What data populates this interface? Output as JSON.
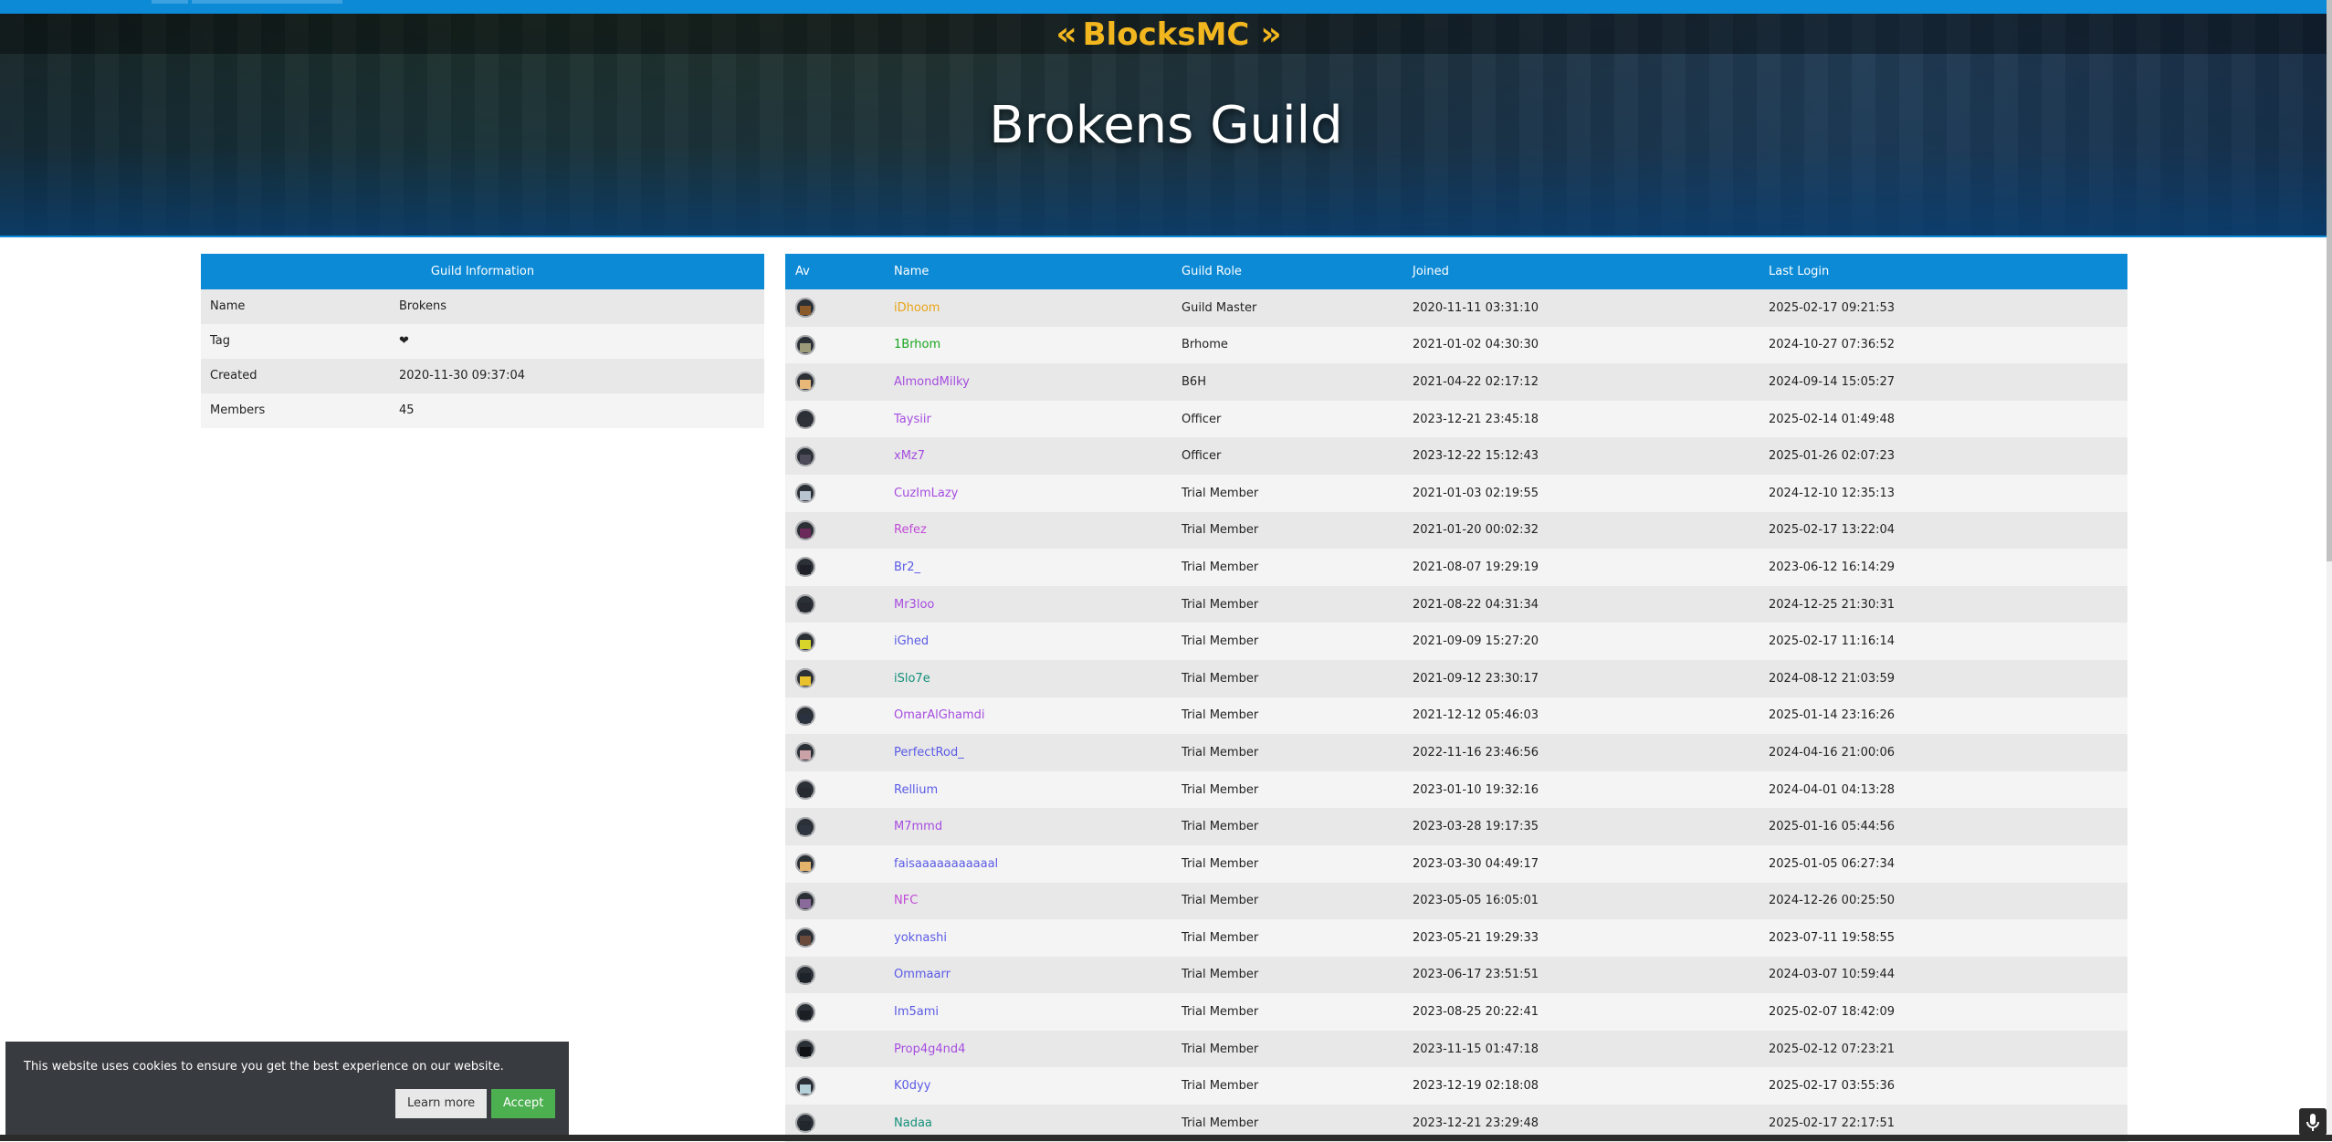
{
  "site": {
    "logo_text": "BlocksMC",
    "logo_left": "«",
    "logo_right": "»"
  },
  "page": {
    "title": "Brokens Guild"
  },
  "guild_info": {
    "header": "Guild Information",
    "rows": [
      {
        "label": "Name",
        "value": "Brokens"
      },
      {
        "label": "Tag",
        "value": "❤"
      },
      {
        "label": "Created",
        "value": "2020-11-30 09:37:04"
      },
      {
        "label": "Members",
        "value": "45"
      }
    ]
  },
  "members_table": {
    "columns": {
      "av": "Av",
      "name": "Name",
      "role": "Guild Role",
      "joined": "Joined",
      "last_login": "Last Login"
    },
    "rows": [
      {
        "name": "iDhoom",
        "name_color": "#e9a416",
        "avatar_color": "#8a5a2a",
        "role": "Guild Master",
        "joined": "2020-11-11 03:31:10",
        "last_login": "2025-02-17 09:21:53"
      },
      {
        "name": "1Brhom",
        "name_color": "#19a51f",
        "avatar_color": "#9b9b7a",
        "role": "Brhome",
        "joined": "2021-01-02 04:30:30",
        "last_login": "2024-10-27 07:36:52"
      },
      {
        "name": "AlmondMilky",
        "name_color": "#a64de0",
        "avatar_color": "#e7b878",
        "role": "B6H",
        "joined": "2021-04-22 02:17:12",
        "last_login": "2024-09-14 15:05:27"
      },
      {
        "name": "Taysiir",
        "name_color": "#a64de0",
        "avatar_color": "#2e3238",
        "role": "Officer",
        "joined": "2023-12-21 23:45:18",
        "last_login": "2025-02-14 01:49:48"
      },
      {
        "name": "xMz7",
        "name_color": "#a64de0",
        "avatar_color": "#4d4a59",
        "role": "Officer",
        "joined": "2023-12-22 15:12:43",
        "last_login": "2025-01-26 02:07:23"
      },
      {
        "name": "CuzImLazy",
        "name_color": "#a64de0",
        "avatar_color": "#b9c4d1",
        "role": "Trial Member",
        "joined": "2021-01-03 02:19:55",
        "last_login": "2024-12-10 12:35:13"
      },
      {
        "name": "Refez",
        "name_color": "#c14bd6",
        "avatar_color": "#6b2a5a",
        "role": "Trial Member",
        "joined": "2021-01-20 00:02:32",
        "last_login": "2025-02-17 13:22:04"
      },
      {
        "name": "Br2_",
        "name_color": "#5a5ae6",
        "avatar_color": "#1e2228",
        "role": "Trial Member",
        "joined": "2021-08-07 19:29:19",
        "last_login": "2023-06-12 16:14:29"
      },
      {
        "name": "Mr3loo",
        "name_color": "#a64de0",
        "avatar_color": "#262a30",
        "role": "Trial Member",
        "joined": "2021-08-22 04:31:34",
        "last_login": "2024-12-25 21:30:31"
      },
      {
        "name": "iGhed",
        "name_color": "#5a5ae6",
        "avatar_color": "#d8d52a",
        "role": "Trial Member",
        "joined": "2021-09-09 15:27:20",
        "last_login": "2025-02-17 11:16:14"
      },
      {
        "name": "iSlo7e",
        "name_color": "#14907a",
        "avatar_color": "#e8c12c",
        "role": "Trial Member",
        "joined": "2021-09-12 23:30:17",
        "last_login": "2024-08-12 21:03:59"
      },
      {
        "name": "OmarAlGhamdi",
        "name_color": "#a64de0",
        "avatar_color": "#2a3240",
        "role": "Trial Member",
        "joined": "2021-12-12 05:46:03",
        "last_login": "2025-01-14 23:16:26"
      },
      {
        "name": "PerfectRod_",
        "name_color": "#5a5ae6",
        "avatar_color": "#c9a3a8",
        "role": "Trial Member",
        "joined": "2022-11-16 23:46:56",
        "last_login": "2024-04-16 21:00:06"
      },
      {
        "name": "Rellium",
        "name_color": "#5a5ae6",
        "avatar_color": "#272b31",
        "role": "Trial Member",
        "joined": "2023-01-10 19:32:16",
        "last_login": "2024-04-01 04:13:28"
      },
      {
        "name": "M7mmd",
        "name_color": "#a64de0",
        "avatar_color": "#2e3440",
        "role": "Trial Member",
        "joined": "2023-03-28 19:17:35",
        "last_login": "2025-01-16 05:44:56"
      },
      {
        "name": "faisaaaaaaaaaaal",
        "name_color": "#5a5ae6",
        "avatar_color": "#e4b46d",
        "role": "Trial Member",
        "joined": "2023-03-30 04:49:17",
        "last_login": "2025-01-05 06:27:34"
      },
      {
        "name": "NFC",
        "name_color": "#c14bd6",
        "avatar_color": "#8a6a9a",
        "role": "Trial Member",
        "joined": "2023-05-05 16:05:01",
        "last_login": "2024-12-26 00:25:50"
      },
      {
        "name": "yoknashi",
        "name_color": "#5a5ae6",
        "avatar_color": "#6a4a3a",
        "role": "Trial Member",
        "joined": "2023-05-21 19:29:33",
        "last_login": "2023-07-11 19:58:55"
      },
      {
        "name": "Ommaarr",
        "name_color": "#5a5ae6",
        "avatar_color": "#1e2329",
        "role": "Trial Member",
        "joined": "2023-06-17 23:51:51",
        "last_login": "2024-03-07 10:59:44"
      },
      {
        "name": "Im5ami",
        "name_color": "#5a5ae6",
        "avatar_color": "#1b1f24",
        "role": "Trial Member",
        "joined": "2023-08-25 20:22:41",
        "last_login": "2025-02-07 18:42:09"
      },
      {
        "name": "Prop4g4nd4",
        "name_color": "#a64de0",
        "avatar_color": "#0f1114",
        "role": "Trial Member",
        "joined": "2023-11-15 01:47:18",
        "last_login": "2025-02-12 07:23:21"
      },
      {
        "name": "K0dyy",
        "name_color": "#5a5ae6",
        "avatar_color": "#b4d0d8",
        "role": "Trial Member",
        "joined": "2023-12-19 02:18:08",
        "last_login": "2025-02-17 03:55:36"
      },
      {
        "name": "Nadaa",
        "name_color": "#14907a",
        "avatar_color": "#22272d",
        "role": "Trial Member",
        "joined": "2023-12-21 23:29:48",
        "last_login": "2025-02-17 22:17:51"
      }
    ]
  },
  "cookie_banner": {
    "message": "This website uses cookies to ensure you get the best experience on our website.",
    "learn_more": "Learn more",
    "accept": "Accept"
  },
  "icons": {
    "microphone": "microphone-icon"
  }
}
